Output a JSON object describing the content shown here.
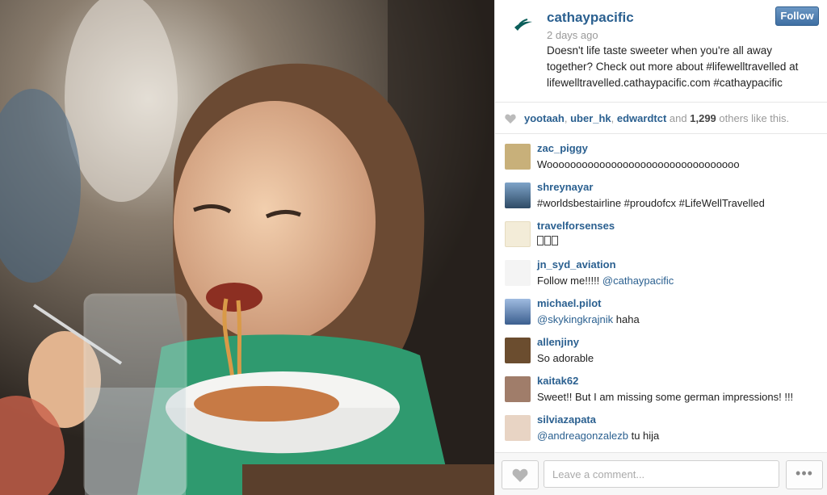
{
  "post": {
    "username": "cathaypacific",
    "time_ago": "2 days ago",
    "caption": "Doesn't life taste sweeter when you're all away together? Check out more about #lifewelltravelled at lifewelltravelled.cathaypacific.com #cathaypacific",
    "follow_label": "Follow"
  },
  "likes": {
    "likers": [
      "yootaah",
      "uber_hk",
      "edwardtct"
    ],
    "and_text": "and",
    "count": "1,299",
    "suffix": "others like this."
  },
  "comments": [
    {
      "user": "zac_piggy",
      "text": "Wooooooooooooooooooooooooooooooooo",
      "avatar_color": "#c8b07a"
    },
    {
      "user": "shreynayar",
      "text": "#worldsbestairline #proudofcx #LifeWellTravelled",
      "avatar_color": "#5a7fa8"
    },
    {
      "user": "travelforsenses",
      "text": "",
      "avatar_color": "#f3ecd8"
    },
    {
      "user": "jn_syd_aviation",
      "text": "Follow me!!!!!",
      "mention": "@cathaypacific",
      "avatar_color": "#f4f4f4"
    },
    {
      "user": "michael.pilot",
      "mention_first": "@skykingkrajnik",
      "text": "haha",
      "avatar_color": "#6a8fc0"
    },
    {
      "user": "allenjiny",
      "text": "So adorable",
      "avatar_color": "#6b4d2f"
    },
    {
      "user": "kaitak62",
      "text": "Sweet!! But I am missing some german impressions! !!!",
      "avatar_color": "#a07d6a"
    },
    {
      "user": "silviazapata",
      "mention_first": "@andreagonzalezb",
      "text": "tu hija",
      "avatar_color": "#e8d4c4"
    }
  ],
  "footer": {
    "comment_placeholder": "Leave a comment...",
    "more_label": "•••"
  },
  "colors": {
    "link": "#2b6090",
    "follow_button": "#4a7bae",
    "muted": "#999999"
  }
}
